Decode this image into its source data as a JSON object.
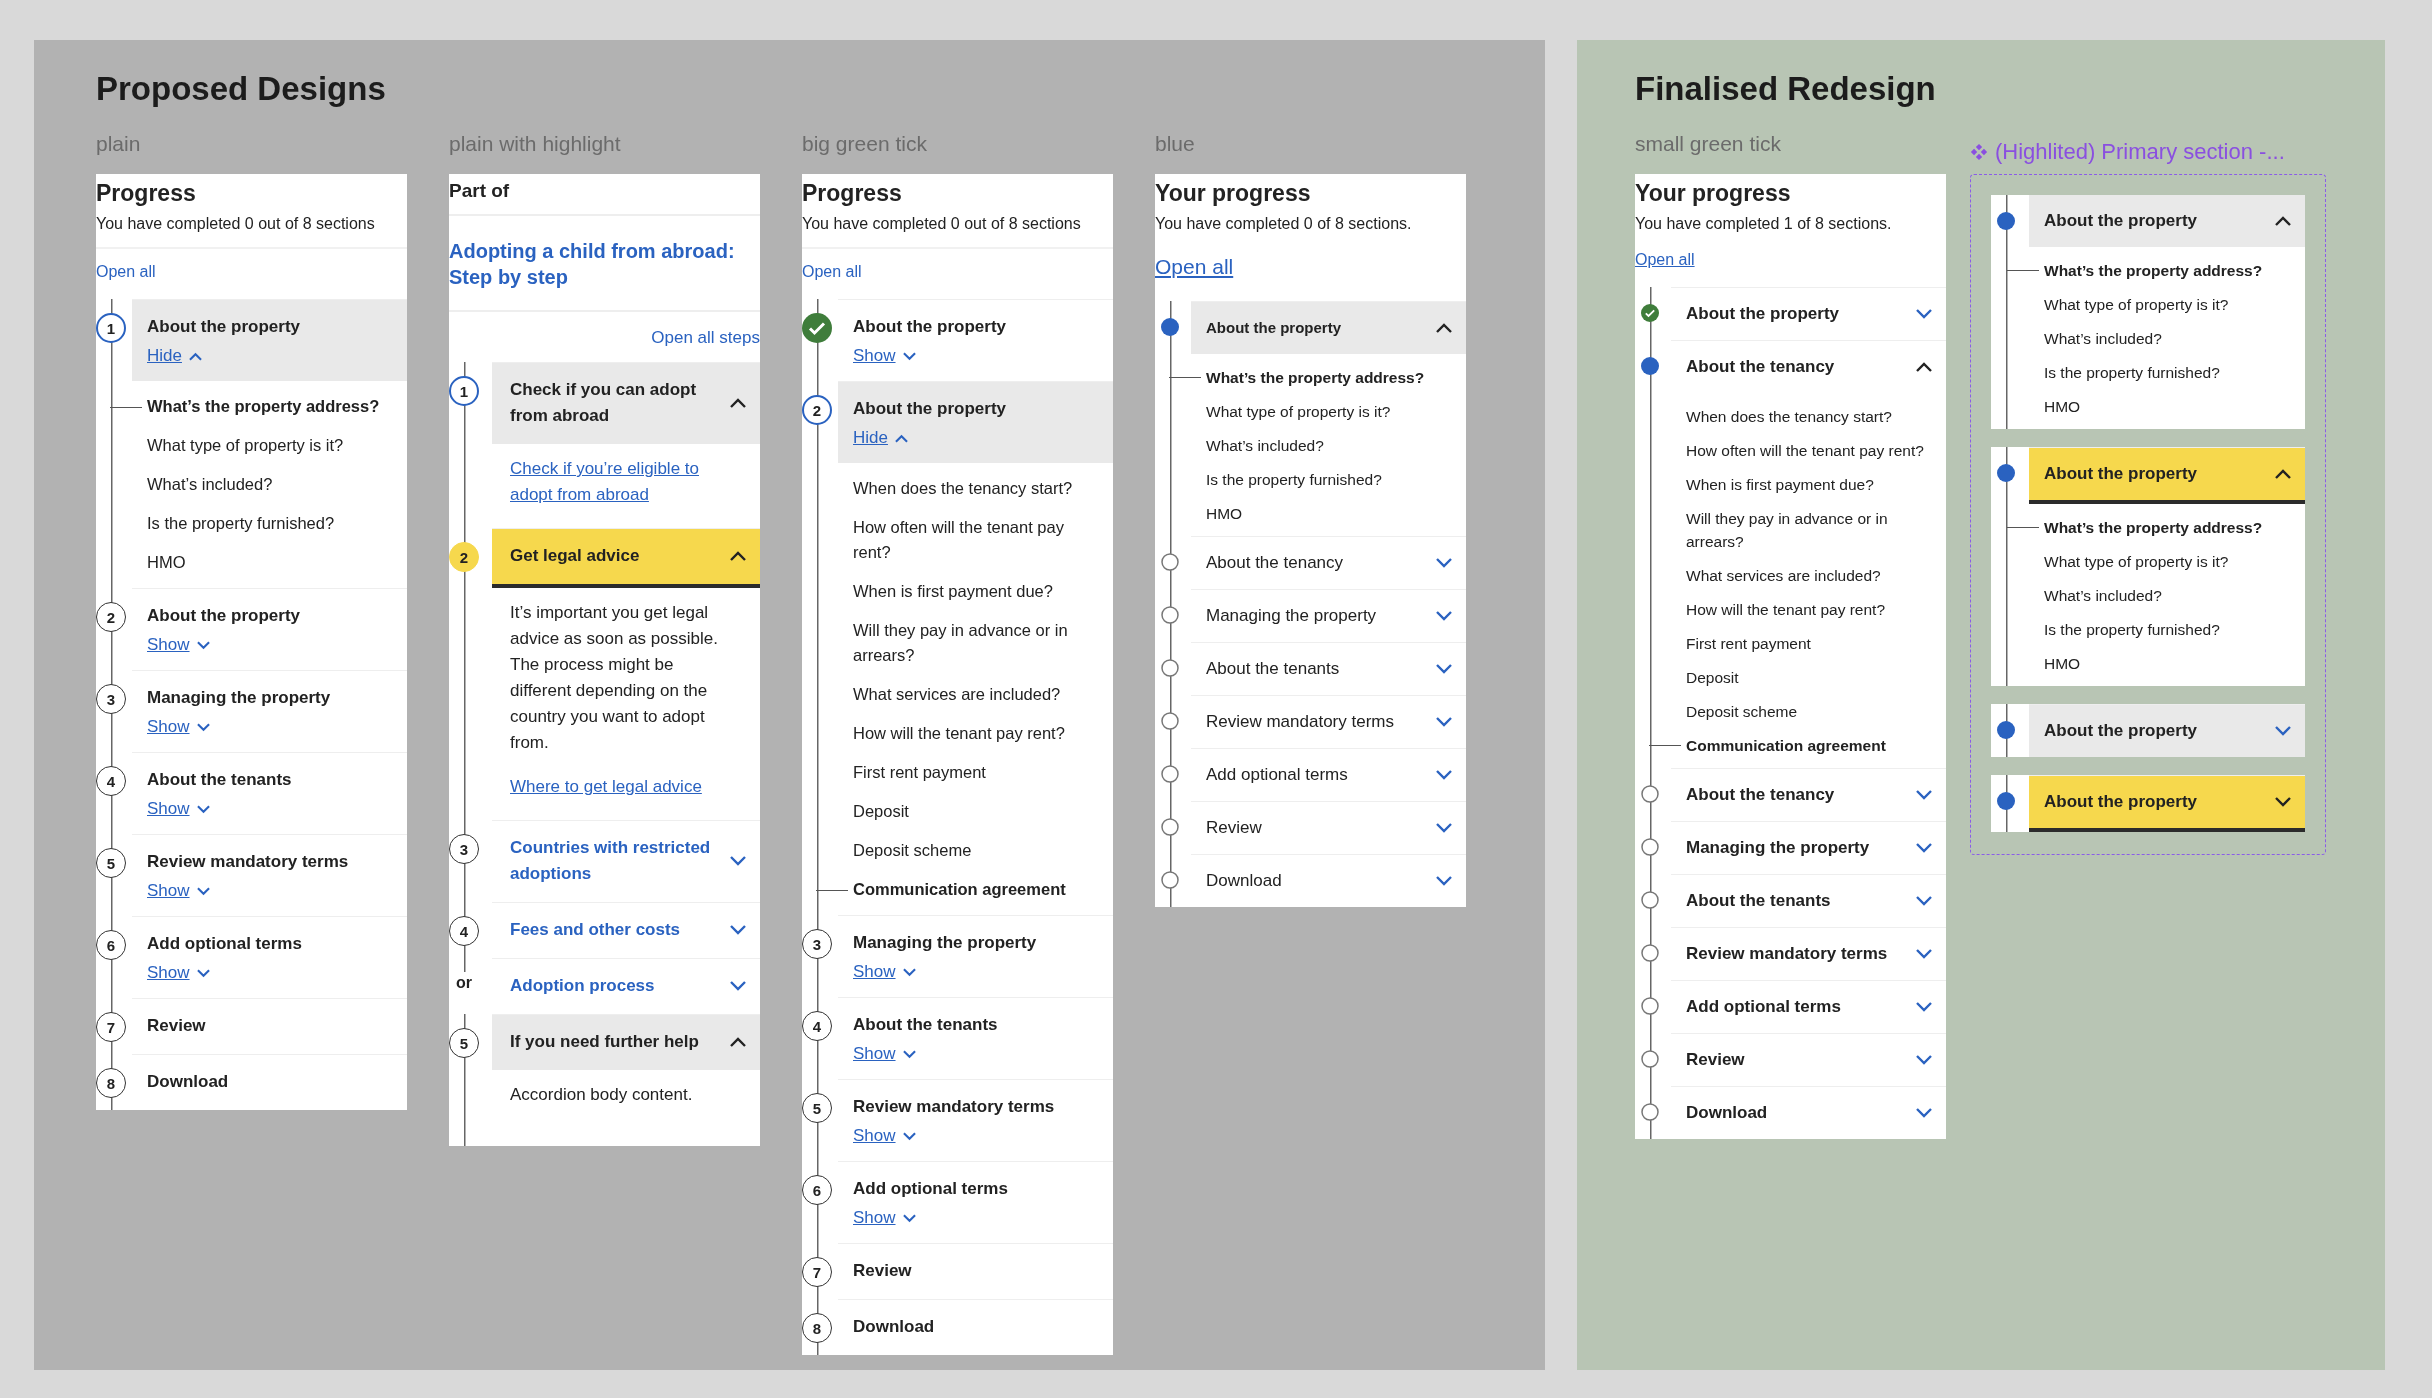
{
  "panels": [
    {
      "title": "Proposed Designs",
      "designs": [
        {
          "kind": "plain",
          "label": "plain",
          "heading": "Progress",
          "summary": "You have completed 0 out of 8 sections",
          "open_all": "Open all",
          "steps": [
            {
              "marker": {
                "kind": "number",
                "text": "1"
              },
              "current": true,
              "shaded": true,
              "highlighted": false,
              "title": "About the property",
              "toggle": {
                "kind": "link",
                "text": "Hide"
              },
              "expanded": true,
              "children": [
                {
                  "text": "What’s the property address?",
                  "current": true
                },
                {
                  "text": "What type of property is it?",
                  "current": false
                },
                {
                  "text": "What’s included?",
                  "current": false
                },
                {
                  "text": "Is the property furnished?",
                  "current": false
                },
                {
                  "text": "HMO",
                  "current": false
                }
              ]
            },
            {
              "marker": {
                "kind": "number",
                "text": "2"
              },
              "current": false,
              "shaded": false,
              "highlighted": false,
              "title": "About the property",
              "toggle": {
                "kind": "link",
                "text": "Show"
              },
              "expanded": false
            },
            {
              "marker": {
                "kind": "number",
                "text": "3"
              },
              "current": false,
              "shaded": false,
              "highlighted": false,
              "title": "Managing the property",
              "toggle": {
                "kind": "link",
                "text": "Show"
              },
              "expanded": false
            },
            {
              "marker": {
                "kind": "number",
                "text": "4"
              },
              "current": false,
              "shaded": false,
              "highlighted": false,
              "title": "About the tenants",
              "toggle": {
                "kind": "link",
                "text": "Show"
              },
              "expanded": false
            },
            {
              "marker": {
                "kind": "number",
                "text": "5"
              },
              "current": false,
              "shaded": false,
              "highlighted": false,
              "title": "Review mandatory terms",
              "toggle": {
                "kind": "link",
                "text": "Show"
              },
              "expanded": false
            },
            {
              "marker": {
                "kind": "number",
                "text": "6"
              },
              "current": false,
              "shaded": false,
              "highlighted": false,
              "title": "Add optional terms",
              "toggle": {
                "kind": "link",
                "text": "Show"
              },
              "expanded": false
            },
            {
              "marker": {
                "kind": "number",
                "text": "7"
              },
              "current": false,
              "shaded": false,
              "highlighted": false,
              "title": "Review"
            },
            {
              "marker": {
                "kind": "number",
                "text": "8"
              },
              "current": false,
              "shaded": false,
              "highlighted": false,
              "title": "Download"
            }
          ]
        },
        {
          "kind": "highlight",
          "label": "plain with highlight",
          "part_of": "Part of",
          "parent_title": "Adopting a child from abroad: Step by step",
          "open_all": "Open all steps",
          "steps": [
            {
              "marker": {
                "kind": "number",
                "text": "1"
              },
              "current": true,
              "shaded": true,
              "highlighted": false,
              "title": "Check if you can adopt from abroad",
              "title_link": false,
              "toggle": {
                "kind": "chevron"
              },
              "expanded": true,
              "body": [
                {
                  "kind": "link",
                  "text": "Check if you’re eligible to adopt from abroad"
                }
              ]
            },
            {
              "marker": {
                "kind": "number",
                "text": "2"
              },
              "current": false,
              "shaded": false,
              "highlighted": true,
              "title": "Get legal advice",
              "title_link": false,
              "toggle": {
                "kind": "chevron"
              },
              "expanded": true,
              "body": [
                {
                  "kind": "text",
                  "text": "It’s important you get legal advice as soon as possible. The  process might be different depending on the country you want to adopt from."
                },
                {
                  "kind": "link",
                  "text": "Where to get legal advice"
                }
              ]
            },
            {
              "marker": {
                "kind": "number",
                "text": "3"
              },
              "current": false,
              "shaded": false,
              "highlighted": false,
              "title": "Countries with restricted adoptions",
              "title_link": true,
              "toggle": {
                "kind": "chevron"
              },
              "expanded": false
            },
            {
              "marker": {
                "kind": "number",
                "text": "4"
              },
              "current": false,
              "shaded": false,
              "highlighted": false,
              "title": "Fees and other costs",
              "title_link": true,
              "toggle": {
                "kind": "chevron"
              },
              "expanded": false
            },
            {
              "marker": {
                "kind": "or",
                "text": "or"
              },
              "shaded": false,
              "highlighted": false,
              "title": "Adoption process",
              "title_link": true,
              "toggle": {
                "kind": "chevron"
              },
              "expanded": false
            },
            {
              "marker": {
                "kind": "number",
                "text": "5"
              },
              "current": false,
              "shaded": true,
              "highlighted": false,
              "title": "If you need further help",
              "title_link": false,
              "toggle": {
                "kind": "chevron"
              },
              "expanded": true,
              "body": [
                {
                  "kind": "text",
                  "text": "Accordion body content."
                }
              ]
            }
          ]
        },
        {
          "kind": "tick",
          "label": "big green tick",
          "heading": "Progress",
          "summary": "You have completed 0 out of 8 sections",
          "open_all": "Open all",
          "steps": [
            {
              "marker": {
                "kind": "tick"
              },
              "shaded": false,
              "highlighted": false,
              "title": "About the property",
              "toggle": {
                "kind": "link",
                "text": "Show"
              },
              "expanded": false
            },
            {
              "marker": {
                "kind": "number",
                "text": "2"
              },
              "current": true,
              "shaded": true,
              "highlighted": false,
              "title": "About the property",
              "toggle": {
                "kind": "link",
                "text": "Hide"
              },
              "expanded": true,
              "children": [
                {
                  "text": "When does the tenancy start?",
                  "current": false
                },
                {
                  "text": "How often will the tenant pay rent?",
                  "current": false
                },
                {
                  "text": "When is first payment due?",
                  "current": false
                },
                {
                  "text": "Will they pay in advance or in arrears?",
                  "current": false
                },
                {
                  "text": "What services are included?",
                  "current": false
                },
                {
                  "text": "How will the tenant pay rent?",
                  "current": false
                },
                {
                  "text": "First rent payment",
                  "current": false
                },
                {
                  "text": "Deposit",
                  "current": false
                },
                {
                  "text": "Deposit scheme",
                  "current": false
                },
                {
                  "text": "Communication agreement",
                  "current": true
                }
              ]
            },
            {
              "marker": {
                "kind": "number",
                "text": "3"
              },
              "current": false,
              "shaded": false,
              "highlighted": false,
              "title": "Managing the property",
              "toggle": {
                "kind": "link",
                "text": "Show"
              },
              "expanded": false
            },
            {
              "marker": {
                "kind": "number",
                "text": "4"
              },
              "current": false,
              "shaded": false,
              "highlighted": false,
              "title": "About the tenants",
              "toggle": {
                "kind": "link",
                "text": "Show"
              },
              "expanded": false
            },
            {
              "marker": {
                "kind": "number",
                "text": "5"
              },
              "current": false,
              "shaded": false,
              "highlighted": false,
              "title": "Review mandatory terms",
              "toggle": {
                "kind": "link",
                "text": "Show"
              },
              "expanded": false
            },
            {
              "marker": {
                "kind": "number",
                "text": "6"
              },
              "current": false,
              "shaded": false,
              "highlighted": false,
              "title": "Add optional terms",
              "toggle": {
                "kind": "link",
                "text": "Show"
              },
              "expanded": false
            },
            {
              "marker": {
                "kind": "number",
                "text": "7"
              },
              "current": false,
              "shaded": false,
              "highlighted": false,
              "title": "Review"
            },
            {
              "marker": {
                "kind": "number",
                "text": "8"
              },
              "current": false,
              "shaded": false,
              "highlighted": false,
              "title": "Download"
            }
          ]
        },
        {
          "kind": "blue",
          "label": "blue",
          "heading": "Your progress",
          "summary": "You have completed 0 of 8 sections.",
          "open_all": "Open all",
          "steps": [
            {
              "marker": {
                "kind": "dot"
              },
              "shaded": true,
              "highlighted": false,
              "title": "About the property",
              "toggle": {
                "kind": "chevron"
              },
              "expanded": true,
              "children": [
                {
                  "text": "What’s the property address?",
                  "current": true
                },
                {
                  "text": "What type of property is it?",
                  "current": false
                },
                {
                  "text": "What’s included?",
                  "current": false
                },
                {
                  "text": "Is the property furnished?",
                  "current": false
                },
                {
                  "text": "HMO",
                  "current": false
                }
              ]
            },
            {
              "marker": {
                "kind": "circle"
              },
              "shaded": false,
              "highlighted": false,
              "title": "About the tenancy",
              "toggle": {
                "kind": "chevron"
              },
              "expanded": false
            },
            {
              "marker": {
                "kind": "circle"
              },
              "shaded": false,
              "highlighted": false,
              "title": "Managing the property",
              "toggle": {
                "kind": "chevron"
              },
              "expanded": false
            },
            {
              "marker": {
                "kind": "circle"
              },
              "shaded": false,
              "highlighted": false,
              "title": "About the tenants",
              "toggle": {
                "kind": "chevron"
              },
              "expanded": false
            },
            {
              "marker": {
                "kind": "circle"
              },
              "shaded": false,
              "highlighted": false,
              "title": "Review mandatory terms",
              "toggle": {
                "kind": "chevron"
              },
              "expanded": false
            },
            {
              "marker": {
                "kind": "circle"
              },
              "shaded": false,
              "highlighted": false,
              "title": "Add optional terms",
              "toggle": {
                "kind": "chevron"
              },
              "expanded": false
            },
            {
              "marker": {
                "kind": "circle"
              },
              "shaded": false,
              "highlighted": false,
              "title": "Review",
              "toggle": {
                "kind": "chevron"
              },
              "expanded": false
            },
            {
              "marker": {
                "kind": "circle"
              },
              "shaded": false,
              "highlighted": false,
              "title": "Download",
              "toggle": {
                "kind": "chevron"
              },
              "expanded": false
            }
          ]
        }
      ]
    },
    {
      "title": "Finalised Redesign",
      "designs": [
        {
          "kind": "small_tick",
          "label": "small green tick",
          "heading": "Your progress",
          "summary": "You have completed 1 of 8 sections.",
          "open_all": "Open all",
          "steps": [
            {
              "marker": {
                "kind": "tick"
              },
              "shaded": false,
              "highlighted": false,
              "title": "About the property",
              "toggle": {
                "kind": "chevron"
              },
              "expanded": false
            },
            {
              "marker": {
                "kind": "dot"
              },
              "shaded": false,
              "highlighted": false,
              "title": "About the tenancy",
              "toggle": {
                "kind": "chevron"
              },
              "expanded": true,
              "children": [
                {
                  "text": "When does the tenancy start?",
                  "current": false
                },
                {
                  "text": "How often will the tenant pay rent?",
                  "current": false
                },
                {
                  "text": "When is first payment due?",
                  "current": false
                },
                {
                  "text": "Will they pay in advance or in arrears?",
                  "current": false
                },
                {
                  "text": "What services are included?",
                  "current": false
                },
                {
                  "text": "How will the tenant pay rent?",
                  "current": false
                },
                {
                  "text": "First rent payment",
                  "current": false
                },
                {
                  "text": "Deposit",
                  "current": false
                },
                {
                  "text": "Deposit scheme",
                  "current": false
                },
                {
                  "text": "Communication agreement",
                  "current": true
                }
              ]
            },
            {
              "marker": {
                "kind": "circle"
              },
              "shaded": false,
              "highlighted": false,
              "title": "About the tenancy",
              "toggle": {
                "kind": "chevron"
              },
              "expanded": false
            },
            {
              "marker": {
                "kind": "circle"
              },
              "shaded": false,
              "highlighted": false,
              "title": "Managing the property",
              "toggle": {
                "kind": "chevron"
              },
              "expanded": false
            },
            {
              "marker": {
                "kind": "circle"
              },
              "shaded": false,
              "highlighted": false,
              "title": "About the tenants",
              "toggle": {
                "kind": "chevron"
              },
              "expanded": false
            },
            {
              "marker": {
                "kind": "circle"
              },
              "shaded": false,
              "highlighted": false,
              "title": "Review mandatory terms",
              "toggle": {
                "kind": "chevron"
              },
              "expanded": false
            },
            {
              "marker": {
                "kind": "circle"
              },
              "shaded": false,
              "highlighted": false,
              "title": "Add optional terms",
              "toggle": {
                "kind": "chevron"
              },
              "expanded": false
            },
            {
              "marker": {
                "kind": "circle"
              },
              "shaded": false,
              "highlighted": false,
              "title": "Review",
              "toggle": {
                "kind": "chevron"
              },
              "expanded": false
            },
            {
              "marker": {
                "kind": "circle"
              },
              "shaded": false,
              "highlighted": false,
              "title": "Download",
              "toggle": {
                "kind": "chevron"
              },
              "expanded": false
            }
          ]
        },
        {
          "kind": "variants",
          "label": "(Highlited) Primary section -...",
          "steps": [
            {
              "marker": {
                "kind": "dot"
              },
              "shaded": true,
              "highlighted": false,
              "title": "About the property",
              "toggle": {
                "kind": "chevron"
              },
              "expanded": true,
              "children": [
                {
                  "text": "What’s the property address?",
                  "current": true
                },
                {
                  "text": "What type of property is it?",
                  "current": false
                },
                {
                  "text": "What’s included?",
                  "current": false
                },
                {
                  "text": "Is the property furnished?",
                  "current": false
                },
                {
                  "text": "HMO",
                  "current": false
                }
              ]
            },
            {
              "marker": {
                "kind": "dot"
              },
              "shaded": false,
              "highlighted": true,
              "title": "About the property",
              "toggle": {
                "kind": "chevron"
              },
              "expanded": true,
              "children": [
                {
                  "text": "What’s the property address?",
                  "current": true
                },
                {
                  "text": "What type of property is it?",
                  "current": false
                },
                {
                  "text": "What’s included?",
                  "current": false
                },
                {
                  "text": "Is the property furnished?",
                  "current": false
                },
                {
                  "text": "HMO",
                  "current": false
                }
              ]
            },
            {
              "marker": {
                "kind": "dot"
              },
              "shaded": true,
              "highlighted": false,
              "title": "About the property",
              "toggle": {
                "kind": "chevron"
              },
              "expanded": false
            },
            {
              "marker": {
                "kind": "dot"
              },
              "shaded": false,
              "highlighted": true,
              "title": "About the property",
              "toggle": {
                "kind": "chevron"
              },
              "expanded": false
            }
          ]
        }
      ]
    }
  ]
}
